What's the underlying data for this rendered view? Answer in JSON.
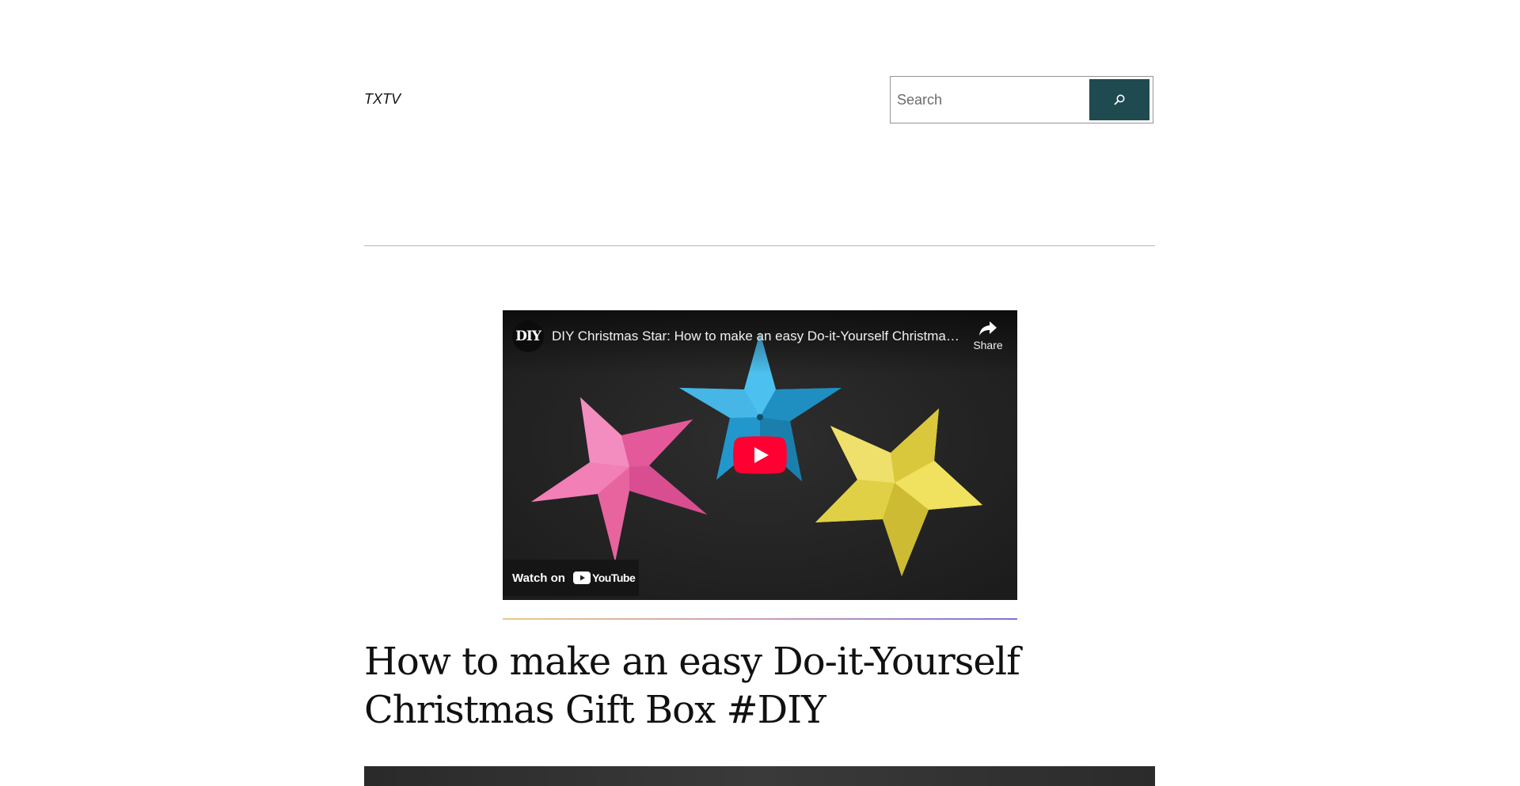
{
  "header": {
    "site_title": "TXTV",
    "search": {
      "placeholder": "Search"
    }
  },
  "video": {
    "channel_avatar_text": "DIY",
    "title": "DIY Christmas Star: How to make an easy Do-it-Yourself Christmas Star",
    "share_label": "Share",
    "watch_on_label": "Watch on",
    "youtube_word": "YouTube"
  },
  "post": {
    "title": "How to make an easy Do-it-Yourself Christmas Gift Box #DIY"
  },
  "colors": {
    "search_button": "#1f4a50",
    "play_button": "#ff0033",
    "star_pink": "#ee6eaa",
    "star_blue": "#2aa6dc",
    "star_yellow": "#e7d84a"
  }
}
